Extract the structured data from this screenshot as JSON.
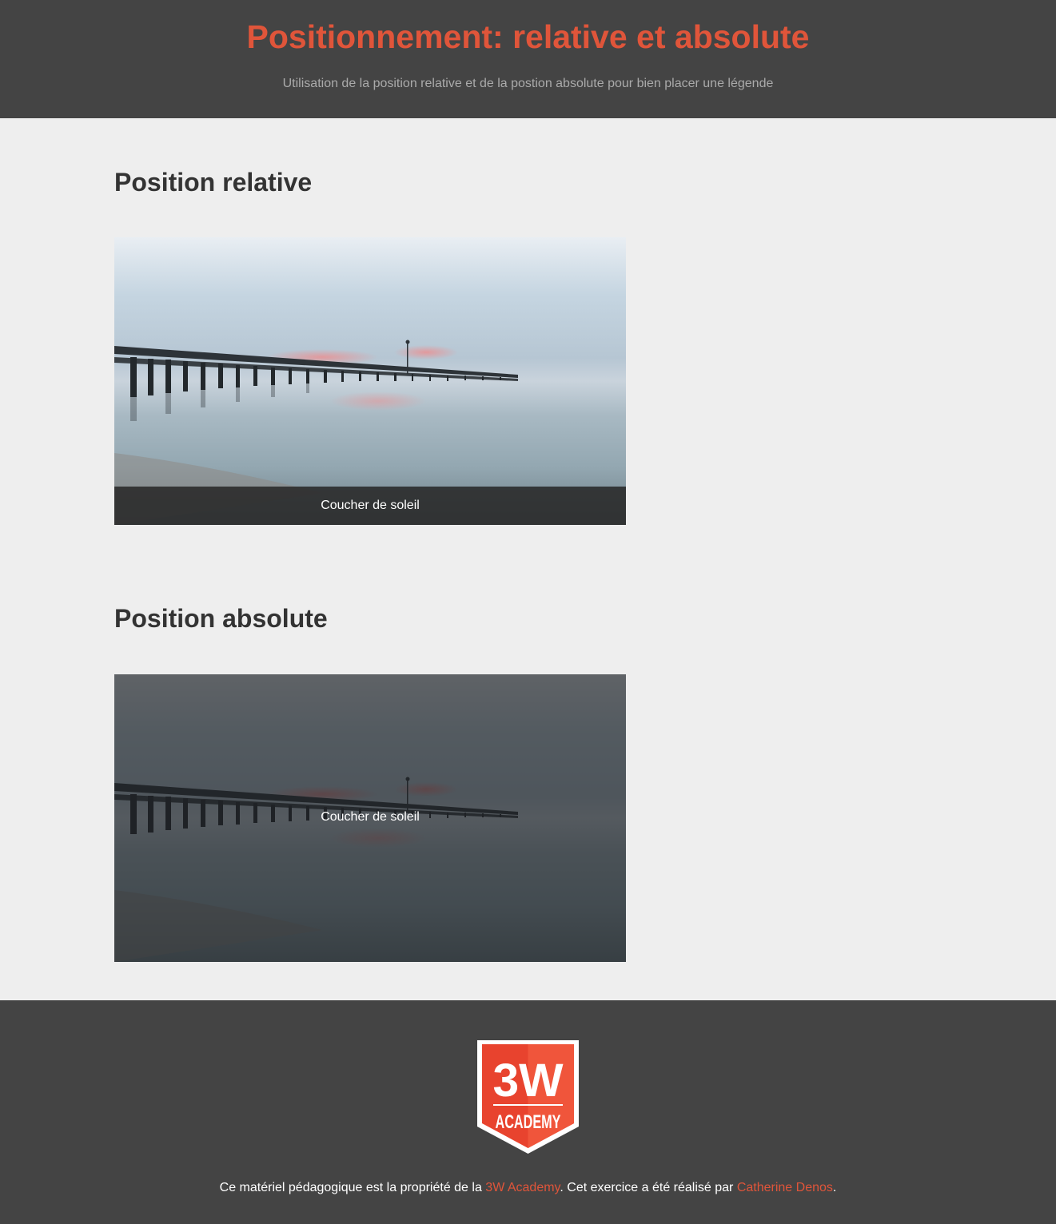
{
  "header": {
    "title": "Positionnement: relative et absolute",
    "subtitle": "Utilisation de la position relative et de la postion absolute pour bien placer une légende"
  },
  "sections": [
    {
      "title": "Position relative",
      "caption": "Coucher de soleil"
    },
    {
      "title": "Position absolute",
      "caption": "Coucher de soleil"
    }
  ],
  "footer": {
    "logo_top": "3W",
    "logo_bottom": "ACADEMY",
    "text_1": "Ce matériel pédagogique est la propriété de la ",
    "link_1": "3W Academy",
    "text_2": ". Cet exercice a été réalisé par ",
    "link_2": "Catherine Denos",
    "text_3": "."
  },
  "colors": {
    "accent": "#e0553a",
    "header_bg": "#444444",
    "page_bg": "#eeeeee",
    "heading": "#333333"
  }
}
